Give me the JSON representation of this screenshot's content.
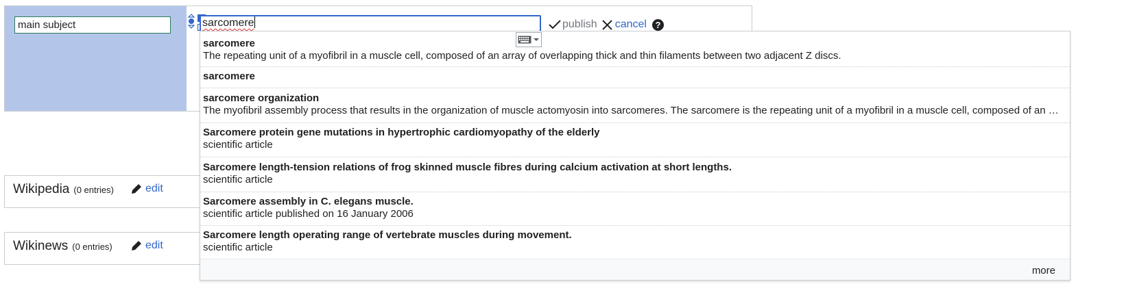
{
  "statement": {
    "property_value": "main subject",
    "value_input": "sarcomere"
  },
  "toolbar": {
    "publish_label": "publish",
    "cancel_label": "cancel",
    "help_glyph": "?"
  },
  "suggestions": {
    "items": [
      {
        "label": "sarcomere",
        "description": "The repeating unit of a myofibril in a muscle cell, composed of an array of overlapping thick and thin filaments between two adjacent Z discs."
      },
      {
        "label": "sarcomere",
        "description": ""
      },
      {
        "label": "sarcomere organization",
        "description": "The myofibril assembly process that results in the organization of muscle actomyosin into sarcomeres. The sarcomere is the repeating unit of a myofibril in a muscle cell, composed of an array of overlapping thick and thin filaments between two adjacent Z discs."
      },
      {
        "label": "Sarcomere protein gene mutations in hypertrophic cardiomyopathy of the elderly",
        "description": "scientific article"
      },
      {
        "label": "Sarcomere length-tension relations of frog skinned muscle fibres during calcium activation at short lengths.",
        "description": "scientific article"
      },
      {
        "label": "Sarcomere assembly in C. elegans muscle.",
        "description": "scientific article published on 16 January 2006"
      },
      {
        "label": "Sarcomere length operating range of vertebrate muscles during movement.",
        "description": "scientific article"
      }
    ],
    "more_label": "more"
  },
  "sitelinks": {
    "wikipedia": {
      "title": "Wikipedia",
      "count": "(0 entries)",
      "edit_label": "edit"
    },
    "wikinews": {
      "title": "Wikinews",
      "count": "(0 entries)",
      "edit_label": "edit"
    }
  },
  "icons": {
    "rank": "rank-selector-icon",
    "snak_type": "snak-type-selector-icon",
    "publish": "checkmark-icon",
    "cancel": "close-icon",
    "help": "help-icon",
    "keyboard": "keyboard-icon",
    "edit": "pencil-icon"
  },
  "colors": {
    "property_background": "#b3c6ea",
    "link": "#3366cc",
    "input_focus_border": "#3366cc",
    "disabled_text": "#72777d"
  }
}
